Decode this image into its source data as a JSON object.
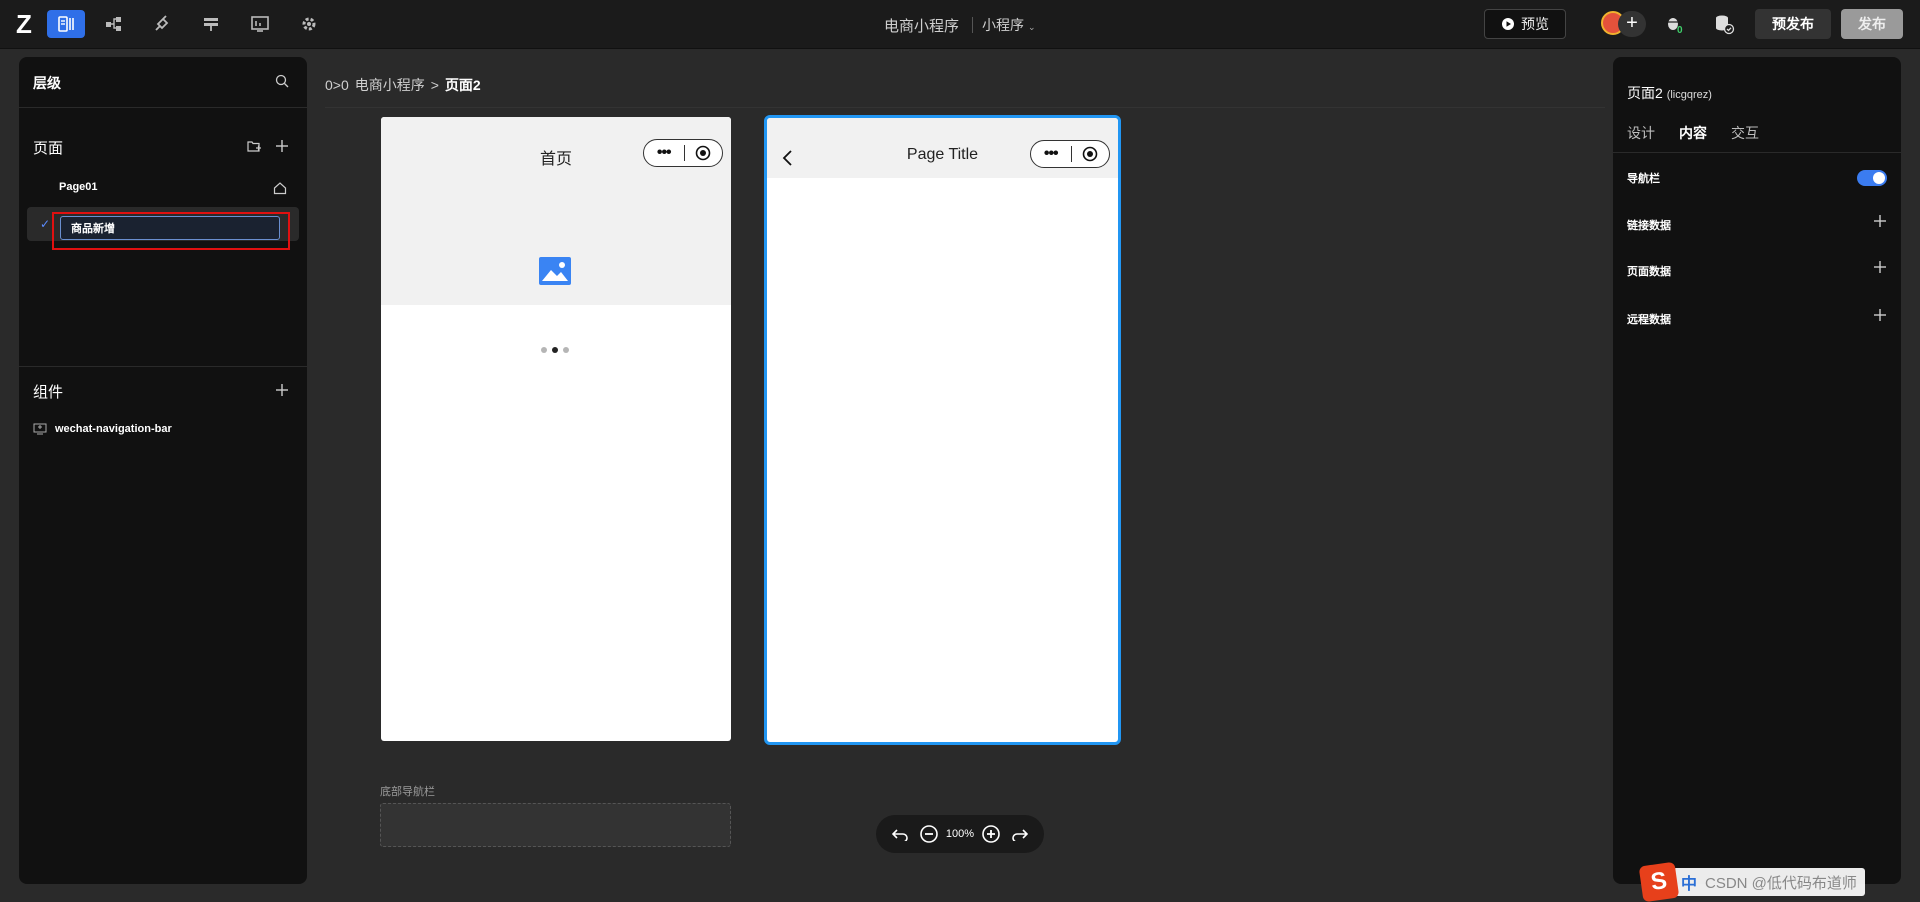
{
  "header": {
    "logo": "Z",
    "project_title": "电商小程序",
    "project_type": "小程序",
    "preview_label": "预览",
    "prepublish_label": "预发布",
    "publish_label": "发布",
    "tool_icons": [
      "pages-icon",
      "flow-icon",
      "plugin-icon",
      "layout-icon",
      "dashboard-icon",
      "settings-icon"
    ]
  },
  "left_panel": {
    "title": "层级",
    "pages_section": "页面",
    "pages": [
      {
        "label": "Page01",
        "home": true
      },
      {
        "label": "商品新增",
        "editing": true,
        "selected": true
      }
    ],
    "components_section": "组件",
    "components": [
      {
        "label": "wechat-navigation-bar"
      }
    ]
  },
  "canvas": {
    "breadcrumb_icon": "0>0",
    "breadcrumb_parent": "电商小程序",
    "breadcrumb_sep": ">",
    "breadcrumb_current": "页面2",
    "phone1_title": "首页",
    "phone2_title": "Page Title",
    "capsule_dots": "•••",
    "bottom_nav_label": "底部导航栏",
    "zoom": "100%"
  },
  "right_panel": {
    "page_name": "页面2",
    "page_id": "(licgqrez)",
    "tabs": [
      {
        "label": "设计",
        "active": false
      },
      {
        "label": "内容",
        "active": true
      },
      {
        "label": "交互",
        "active": false
      }
    ],
    "rows": [
      {
        "label": "导航栏",
        "type": "toggle",
        "value": true
      },
      {
        "label": "链接数据",
        "type": "add"
      },
      {
        "label": "页面数据",
        "type": "add"
      },
      {
        "label": "远程数据",
        "type": "add"
      }
    ]
  },
  "overlay": {
    "ime_logo": "S",
    "ime_lang": "中",
    "watermark": "CSDN @低代码布道师"
  },
  "colors": {
    "accent": "#2f6fe8",
    "selection_border": "#2196f3",
    "highlight_box": "#e01010",
    "panel_bg": "#111111",
    "canvas_bg": "#2a2a2a"
  }
}
